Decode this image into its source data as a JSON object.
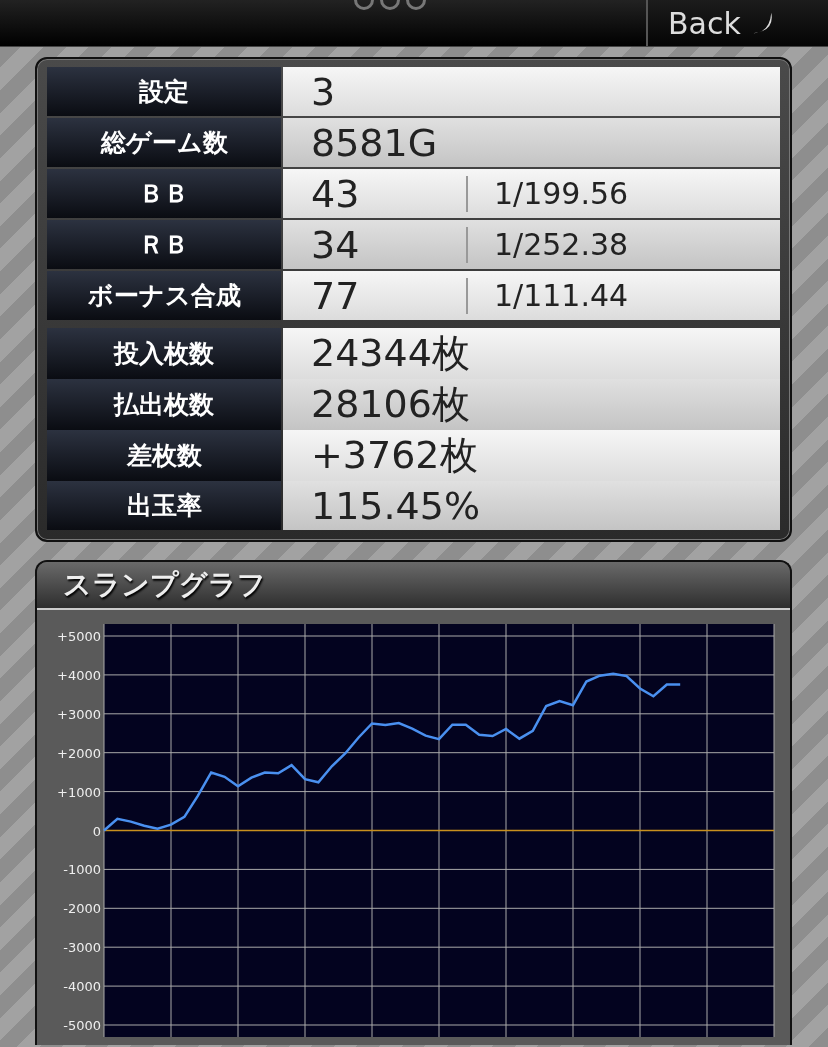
{
  "top_bar": {
    "back_button": "Back"
  },
  "stats": {
    "groups": [
      [
        {
          "label": "設定",
          "value": "3"
        },
        {
          "label": "総ゲーム数",
          "value": "8581G"
        },
        {
          "label": "ＢＢ",
          "value": "43",
          "rate": "1/199.56"
        },
        {
          "label": "ＲＢ",
          "value": "34",
          "rate": "1/252.38"
        },
        {
          "label": "ボーナス合成",
          "value": "77",
          "rate": "1/111.44"
        }
      ],
      [
        {
          "label": "投入枚数",
          "value": "24344枚"
        },
        {
          "label": "払出枚数",
          "value": "28106枚"
        },
        {
          "label": "差枚数",
          "value": "+3762枚"
        },
        {
          "label": "出玉率",
          "value": "115.45%"
        }
      ]
    ]
  },
  "graph": {
    "title": "スランプグラフ",
    "chart_data": {
      "type": "line",
      "ylim": [
        -5000,
        5000
      ],
      "grid": true,
      "ref_lines": [
        {
          "axis": "y",
          "value": 0,
          "color": "#c8901e"
        }
      ],
      "yticks": [
        {
          "value": 5000,
          "label": "+5000"
        },
        {
          "value": 4000,
          "label": "+4000"
        },
        {
          "value": 3000,
          "label": "+3000"
        },
        {
          "value": 2000,
          "label": "+2000"
        },
        {
          "value": 1000,
          "label": "+1000"
        },
        {
          "value": 0,
          "label": "0"
        },
        {
          "value": -1000,
          "label": "-1000"
        },
        {
          "value": -2000,
          "label": "-2000"
        },
        {
          "value": -3000,
          "label": "-3000"
        },
        {
          "value": -4000,
          "label": "-4000"
        },
        {
          "value": -5000,
          "label": "-5000"
        }
      ],
      "categories": [
        null,
        null,
        null,
        null,
        null,
        null,
        null,
        null,
        null,
        null,
        null,
        null,
        null,
        null,
        null,
        null,
        null,
        null,
        null,
        null,
        null,
        null,
        null,
        null,
        null,
        null,
        null,
        null,
        null,
        null,
        null,
        null,
        null,
        null,
        null,
        null,
        null,
        null,
        null,
        null,
        null,
        null,
        null,
        null,
        null,
        null,
        null,
        null,
        null,
        null,
        null
      ],
      "series": [
        {
          "color": "#4a90f0",
          "values": [
            0,
            300,
            230,
            120,
            50,
            150,
            350,
            890,
            1490,
            1380,
            1140,
            1360,
            1490,
            1470,
            1680,
            1320,
            1240,
            1650,
            1980,
            2390,
            2750,
            2710,
            2760,
            2620,
            2440,
            2350,
            2720,
            2720,
            2460,
            2430,
            2610,
            2360,
            2560,
            3200,
            3330,
            3220,
            3830,
            3980,
            4030,
            3970,
            3650,
            3450,
            3750,
            3750,
            null,
            null,
            null,
            null,
            null,
            null,
            null
          ]
        }
      ]
    }
  }
}
